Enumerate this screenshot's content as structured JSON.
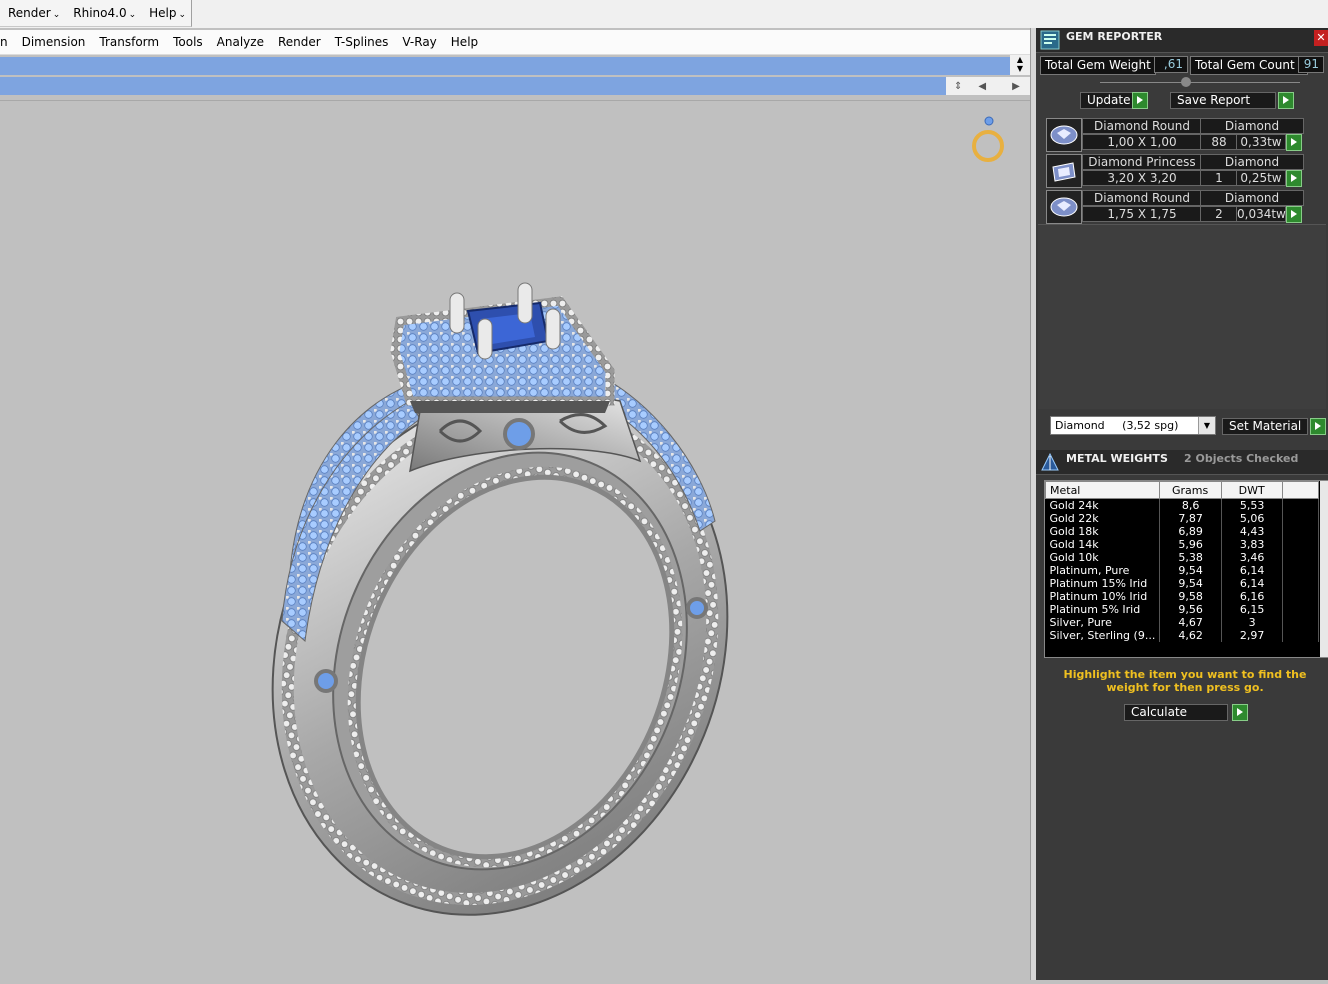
{
  "top_menu": [
    {
      "label": "Render"
    },
    {
      "label": "Rhino4.0"
    },
    {
      "label": "Help"
    }
  ],
  "menu_bar": [
    "n",
    "Dimension",
    "Transform",
    "Tools",
    "Analyze",
    "Render",
    "T-Splines",
    "V-Ray",
    "Help"
  ],
  "gem_reporter": {
    "title": "GEM REPORTER",
    "total_weight_label": "Total Gem Weight",
    "total_weight_value": ",61",
    "total_count_label": "Total Gem Count",
    "total_count_value": "91",
    "update_label": "Update",
    "save_label": "Save Report",
    "gems": [
      {
        "name": "Diamond Round",
        "material": "Diamond",
        "size": "1,00 X 1,00",
        "count": "88",
        "weight": "0,33tw",
        "shape": "round"
      },
      {
        "name": "Diamond Princess",
        "material": "Diamond",
        "size": "3,20 X 3,20",
        "count": "1",
        "weight": "0,25tw",
        "shape": "princess"
      },
      {
        "name": "Diamond Round",
        "material": "Diamond",
        "size": "1,75 X 1,75",
        "count": "2",
        "weight": "0,034tw",
        "shape": "round"
      }
    ],
    "material_select": "Diamond     (3,52 spg)",
    "set_material_label": "Set Material"
  },
  "metal_weights": {
    "title": "METAL WEIGHTS",
    "objects_checked": "2 Objects Checked",
    "headers": [
      "Metal",
      "Grams",
      "DWT"
    ],
    "rows": [
      [
        "Gold 24k",
        "8,6",
        "5,53"
      ],
      [
        "Gold 22k",
        "7,87",
        "5,06"
      ],
      [
        "Gold 18k",
        "6,89",
        "4,43"
      ],
      [
        "Gold 14k",
        "5,96",
        "3,83"
      ],
      [
        "Gold 10k",
        "5,38",
        "3,46"
      ],
      [
        "Platinum, Pure",
        "9,54",
        "6,14"
      ],
      [
        "Platinum 15% Irid",
        "9,54",
        "6,14"
      ],
      [
        "Platinum 10% Irid",
        "9,58",
        "6,16"
      ],
      [
        "Platinum 5% Irid",
        "9,56",
        "6,15"
      ],
      [
        "Silver, Pure",
        "4,67",
        "3"
      ],
      [
        "Silver, Sterling (9...",
        "4,62",
        "2,97"
      ]
    ],
    "hint": "Highlight the item you want to find the weight for then press go.",
    "calculate_label": "Calculate"
  }
}
